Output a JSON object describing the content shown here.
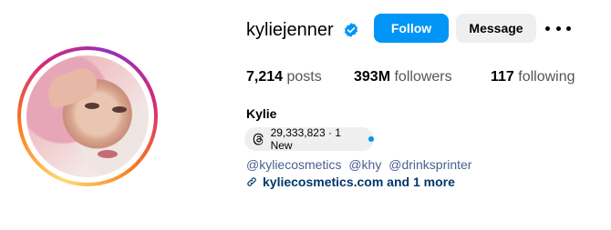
{
  "profile": {
    "username": "kyliejenner",
    "full_name": "Kylie",
    "verified": true,
    "avatar": "profile-photo"
  },
  "actions": {
    "follow_label": "Follow",
    "message_label": "Message",
    "more_icon": "more-options-icon"
  },
  "stats": {
    "posts_count": "7,214",
    "posts_label": "posts",
    "followers_count": "393M",
    "followers_label": "followers",
    "following_count": "117",
    "following_label": "following"
  },
  "threads": {
    "icon": "threads-icon",
    "text": "29,333,823 · 1 New",
    "new_dot_color": "#0095f6"
  },
  "bio": {
    "mentions": [
      "@kyliecosmetics",
      "@khy",
      "@drinksprinter"
    ]
  },
  "website": {
    "icon": "link-icon",
    "text": "kyliecosmetics.com and 1 more"
  },
  "colors": {
    "accent": "#0095f6",
    "link": "#00376b",
    "mention": "#4a5f8f",
    "button_secondary": "#efefef"
  }
}
